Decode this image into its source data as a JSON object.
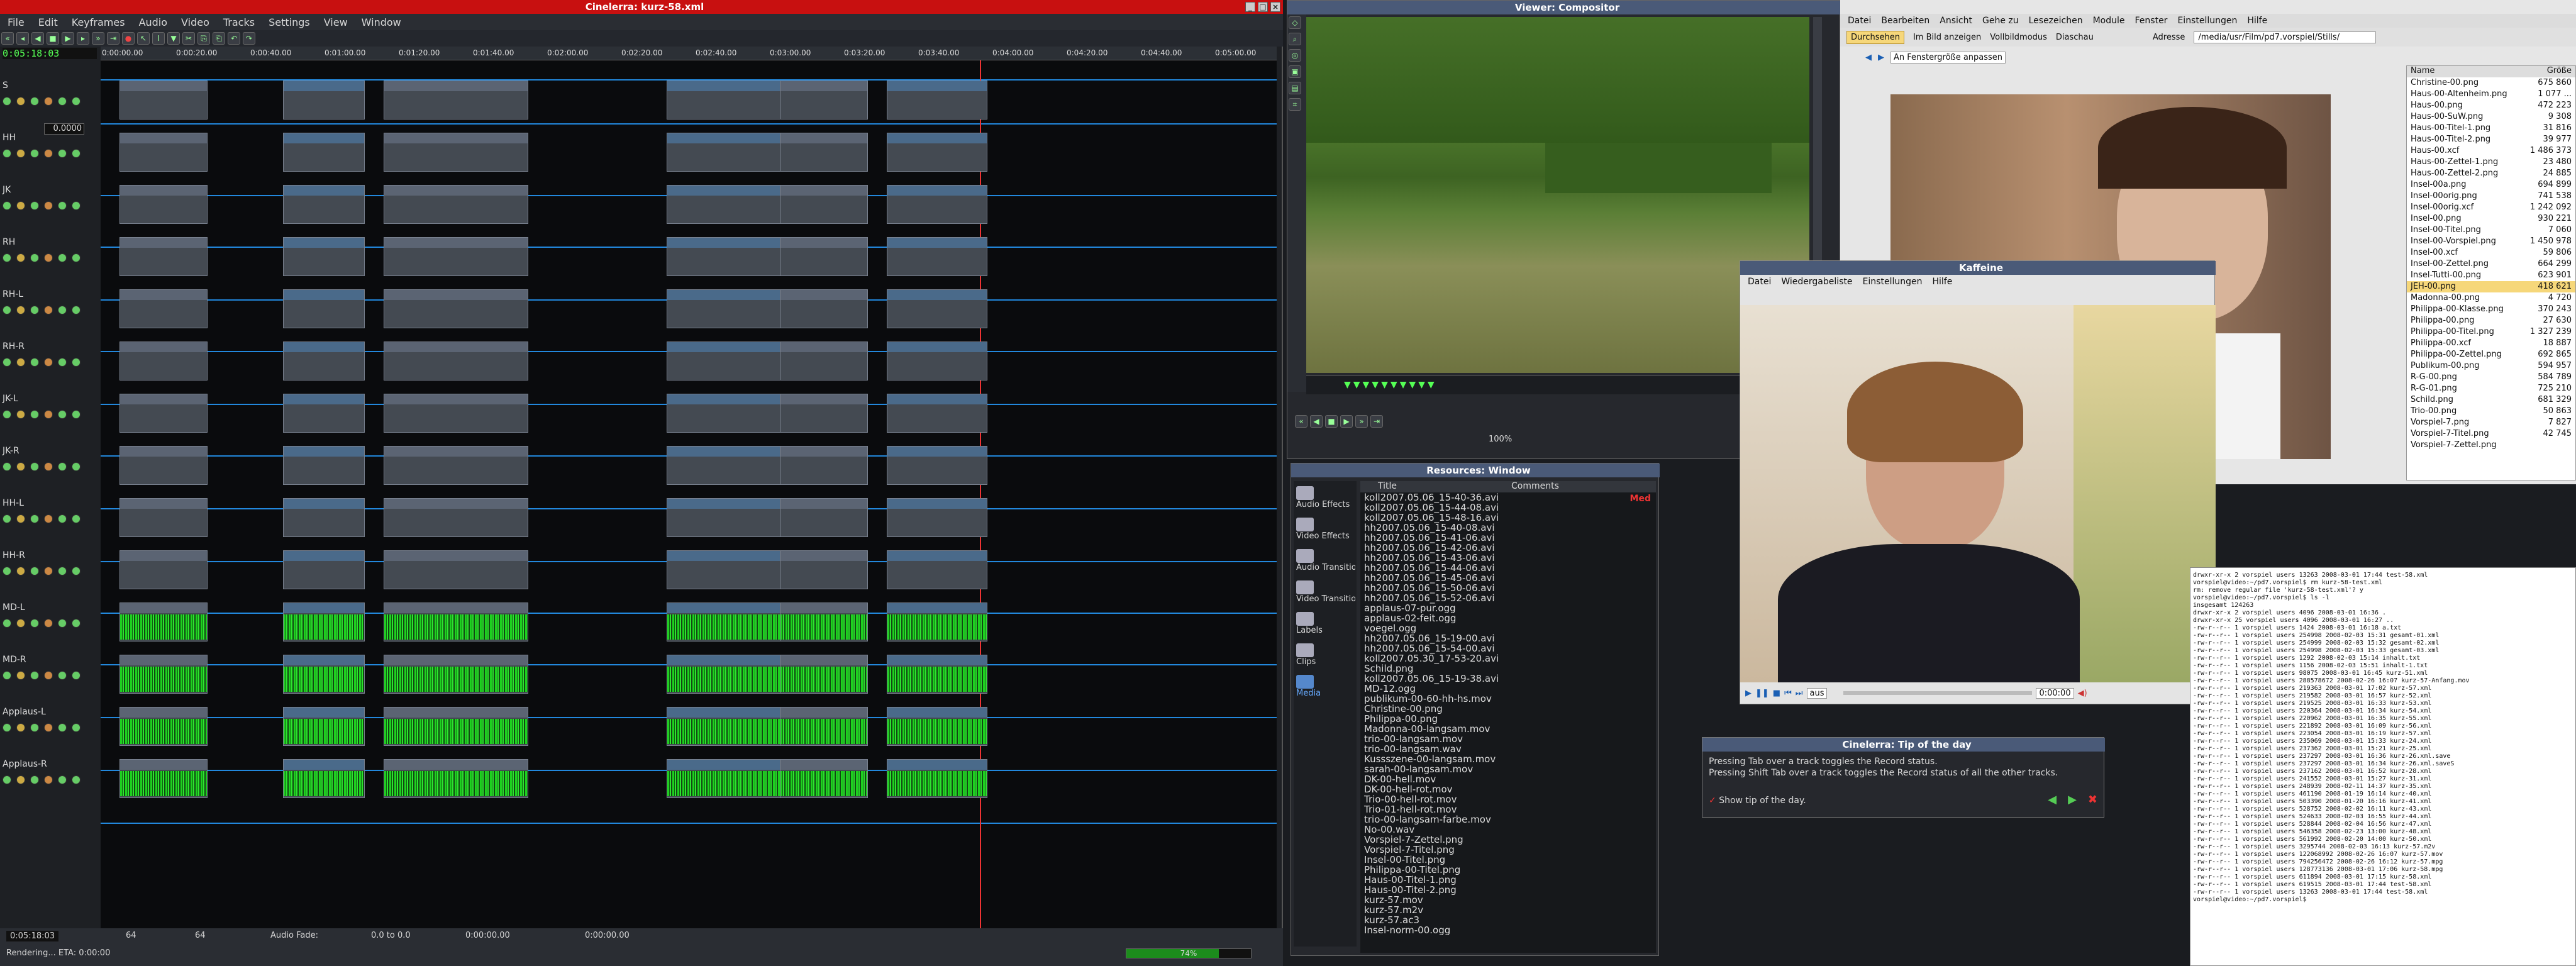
{
  "cinelerra": {
    "title": "Cinelerra: kurz-58.xml",
    "menu": [
      "File",
      "Edit",
      "Keyframes",
      "Audio",
      "Video",
      "Tracks",
      "Settings",
      "View",
      "Window"
    ],
    "timecode": "0:05:18:03",
    "ruler": [
      "0:00:00.00",
      "0:00:20.00",
      "0:00:40.00",
      "0:01:00.00",
      "0:01:20.00",
      "0:01:40.00",
      "0:02:00.00",
      "0:02:20.00",
      "0:02:40.00",
      "0:03:00.00",
      "0:03:20.00",
      "0:03:40.00",
      "0:04:00.00",
      "0:04:20.00",
      "0:04:40.00",
      "0:05:00.00"
    ],
    "zoom_value": "0.0000",
    "tracks": [
      "S",
      "HH",
      "JK",
      "RH",
      "RH-L",
      "RH-R",
      "JK-L",
      "JK-R",
      "HH-L",
      "HH-R",
      "MD-L",
      "MD-R",
      "Applaus-L",
      "Applaus-R"
    ],
    "status": {
      "pos": "0:05:18:03",
      "s1": "64",
      "s2": "64",
      "fade_label": "Audio Fade:",
      "fade": "0.0 to 0.0",
      "t1": "0:00:00.00",
      "t2": "0:00:00.00",
      "rendering": "Rendering... ETA: 0:00:00",
      "progress_pct": "74%",
      "progress": 0.74
    }
  },
  "viewer": {
    "title": "Viewer: Compositor",
    "zoom": "100%"
  },
  "resources": {
    "title": "Resources: Window",
    "folders": [
      "Audio Effects",
      "Video Effects",
      "Audio Transitions",
      "Video Transitions",
      "Labels",
      "Clips",
      "Media"
    ],
    "col_title": "Title",
    "col_comments": "Comments",
    "files": [
      "koll2007.05.06_15-40-36.avi",
      "koll2007.05.06_15-44-08.avi",
      "koll2007.05.06_15-48-16.avi",
      "hh2007.05.06_15-40-08.avi",
      "hh2007.05.06_15-41-06.avi",
      "hh2007.05.06_15-42-06.avi",
      "hh2007.05.06_15-43-06.avi",
      "hh2007.05.06_15-44-06.avi",
      "hh2007.05.06_15-45-06.avi",
      "hh2007.05.06_15-50-06.avi",
      "hh2007.05.06_15-52-06.avi",
      "applaus-07-pur.ogg",
      "applaus-02-feit.ogg",
      "voegel.ogg",
      "hh2007.05.06_15-19-00.avi",
      "hh2007.05.06_15-54-00.avi",
      "koll2007.05.30_17-53-20.avi",
      "Schild.png",
      "koll2007.05.06_15-19-38.avi",
      "MD-12.ogg",
      "publikum-00-60-hh-hs.mov",
      "Christine-00.png",
      "Philippa-00.png",
      "Madonna-00-langsam.mov",
      "trio-00-langsam.mov",
      "trio-00-langsam.wav",
      "Kussszene-00-langsam.mov",
      "sarah-00-langsam.mov",
      "DK-00-hell.mov",
      "DK-00-hell-rot.mov",
      "Trio-00-hell-rot.mov",
      "Trio-01-hell-rot.mov",
      "trio-00-langsam-farbe.mov",
      "No-00.wav",
      "Vorspiel-7-Zettel.png",
      "Vorspiel-7-Titel.png",
      "Insel-00-Titel.png",
      "Philippa-00-Titel.png",
      "Haus-00-Titel-1.png",
      "Haus-00-Titel-2.png",
      "kurz-57.mov",
      "kurz-57.m2v",
      "kurz-57.ac3",
      "Insel-norm-00.ogg"
    ],
    "red": "Med"
  },
  "browser": {
    "menu": [
      "Datei",
      "Bearbeiten",
      "Ansicht",
      "Gehe zu",
      "Lesezeichen",
      "Module",
      "Fenster",
      "Einstellungen",
      "Hilfe"
    ],
    "tb": [
      "Durchsehen",
      "Im Bild anzeigen",
      "Vollbildmodus",
      "Diaschau"
    ],
    "address_label": "Adresse",
    "address": "/media/usr/Film/pd7.vorspiel/Stills/",
    "fit": "An Fenstergröße anpassen",
    "col_name": "Name",
    "col_size": "Größe",
    "files": [
      [
        "Christine-00.png",
        "675 860"
      ],
      [
        "Haus-00-Altenheim.png",
        "1 077 ..."
      ],
      [
        "Haus-00.png",
        "472 223"
      ],
      [
        "Haus-00-SuW.png",
        "9 308"
      ],
      [
        "Haus-00-Titel-1.png",
        "31 816"
      ],
      [
        "Haus-00-Titel-2.png",
        "39 977"
      ],
      [
        "Haus-00.xcf",
        "1 486 373"
      ],
      [
        "Haus-00-Zettel-1.png",
        "23 480"
      ],
      [
        "Haus-00-Zettel-2.png",
        "24 885"
      ],
      [
        "Insel-00a.png",
        "694 899"
      ],
      [
        "Insel-00orig.png",
        "741 538"
      ],
      [
        "Insel-00orig.xcf",
        "1 242 092"
      ],
      [
        "Insel-00.png",
        "930 221"
      ],
      [
        "Insel-00-Titel.png",
        "7 060"
      ],
      [
        "Insel-00-Vorspiel.png",
        "1 450 978"
      ],
      [
        "Insel-00.xcf",
        "59 806"
      ],
      [
        "Insel-00-Zettel.png",
        "664 299"
      ],
      [
        "Insel-Tutti-00.png",
        "623 901"
      ],
      [
        "JEH-00.png",
        "418 621"
      ],
      [
        "Madonna-00.png",
        "4 720"
      ],
      [
        "Philippa-00-Klasse.png",
        "370 243"
      ],
      [
        "Philippa-00.png",
        "27 630"
      ],
      [
        "Philippa-00-Titel.png",
        "1 327 239"
      ],
      [
        "Philippa-00.xcf",
        "18 887"
      ],
      [
        "Philippa-00-Zettel.png",
        "692 865"
      ],
      [
        "Publikum-00.png",
        "594 957"
      ],
      [
        "R-G-00.png",
        "584 789"
      ],
      [
        "R-G-01.png",
        "725 210"
      ],
      [
        "Schild.png",
        "681 329"
      ],
      [
        "Trio-00.png",
        "50 863"
      ],
      [
        "Vorspiel-7.png",
        "7 827"
      ],
      [
        "Vorspiel-7-Titel.png",
        "42 745"
      ],
      [
        "Vorspiel-7-Zettel.png",
        ""
      ]
    ],
    "selected": 18
  },
  "player": {
    "title": "Kaffeine",
    "menu": [
      "Datei",
      "Wiedergabeliste",
      "Einstellungen",
      "Hilfe"
    ],
    "time": "0:00:00",
    "audio": "aus"
  },
  "tip": {
    "title": "Cinelerra: Tip of the day",
    "text1": "Pressing Tab over a track toggles the Record status.",
    "text2": "Pressing Shift Tab over a track toggles the Record status of all the other tracks.",
    "show": "Show tip of the day."
  },
  "terminal": {
    "lines": [
      "drwxr-xr-x  2 vorspiel users       13263 2008-03-01 17:44 test-58.xml",
      "vorspiel@video:~/pd7.vorspiel$ rm kurz-58-test.xml",
      "rm: remove regular file 'kurz-58-test.xml'? y",
      "vorspiel@video:~/pd7.vorspiel$ ls -l",
      "insgesamt 124263",
      "drwxr-xr-x  2 vorspiel users        4096 2008-03-01 16:36 .",
      "drwxr-xr-x 25 vorspiel users        4096 2008-03-01 16:27 ..",
      "-rw-r--r--  1 vorspiel users        1424 2008-03-01 16:18 a.txt",
      "-rw-r--r--  1 vorspiel users      254998 2008-02-03 15:31 gesamt-01.xml",
      "-rw-r--r--  1 vorspiel users      254999 2008-02-03 15:32 gesamt-02.xml",
      "-rw-r--r--  1 vorspiel users      254998 2008-02-03 15:33 gesamt-03.xml",
      "-rw-r--r--  1 vorspiel users        1292 2008-02-03 15:14 inhalt.txt",
      "-rw-r--r--  1 vorspiel users        1156 2008-02-03 15:51 inhalt-1.txt",
      "-rw-r--r--  1 vorspiel users       98075 2008-03-01 16:45 kurz-51.xml",
      "-rw-r--r--  1 vorspiel users   288578672 2008-02-26 16:07 kurz-57-Anfang.mov",
      "-rw-r--r--  1 vorspiel users      219363 2008-03-01 17:02 kurz-57.xml",
      "-rw-r--r--  1 vorspiel users      219582 2008-03-01 16:57 kurz-52.xml",
      "-rw-r--r--  1 vorspiel users      219525 2008-03-01 16:33 kurz-53.xml",
      "-rw-r--r--  1 vorspiel users      220364 2008-03-01 16:34 kurz-54.xml",
      "-rw-r--r--  1 vorspiel users      220962 2008-03-01 16:35 kurz-55.xml",
      "-rw-r--r--  1 vorspiel users      221892 2008-03-01 16:09 kurz-56.xml",
      "-rw-r--r--  1 vorspiel users      223054 2008-03-01 16:19 kurz-57.xml",
      "-rw-r--r--  1 vorspiel users      235069 2008-03-01 15:33 kurz-24.xml",
      "-rw-r--r--  1 vorspiel users      237362 2008-03-01 15:21 kurz-25.xml",
      "-rw-r--r--  1 vorspiel users      237297 2008-03-01 16:36 kurz-26.xml.save",
      "-rw-r--r--  1 vorspiel users      237297 2008-03-01 16:34 kurz-26.xml.saveS",
      "-rw-r--r--  1 vorspiel users      237162 2008-03-01 16:52 kurz-28.xml",
      "-rw-r--r--  1 vorspiel users      241552 2008-03-01 15:27 kurz-31.xml",
      "-rw-r--r--  1 vorspiel users      248939 2008-02-11 14:37 kurz-35.xml",
      "-rw-r--r--  1 vorspiel users      461190 2008-01-19 16:14 kurz-40.xml",
      "-rw-r--r--  1 vorspiel users      503390 2008-01-20 16:16 kurz-41.xml",
      "-rw-r--r--  1 vorspiel users      528752 2008-02-02 16:11 kurz-43.xml",
      "-rw-r--r--  1 vorspiel users      524633 2008-02-03 16:55 kurz-44.xml",
      "-rw-r--r--  1 vorspiel users      528844 2008-02-04 16:56 kurz-47.xml",
      "-rw-r--r--  1 vorspiel users      546358 2008-02-23 13:00 kurz-48.xml",
      "-rw-r--r--  1 vorspiel users      561992 2008-02-20 14:00 kurz-50.xml",
      "-rw-r--r--  1 vorspiel users     3295744 2008-02-03 16:13 kurz-57.m2v",
      "-rw-r--r--  1 vorspiel users   122068992 2008-02-26 16:07 kurz-57.mov",
      "-rw-r--r--  1 vorspiel users   794256472 2008-02-26 16:12 kurz-57.mpg",
      "-rw-r--r--  1 vorspiel users   128773136 2008-03-01 17:06 kurz-58.mpg",
      "-rw-r--r--  1 vorspiel users      611894 2008-03-01 17:15 kurz-58.xml",
      "-rw-r--r--  1 vorspiel users      619515 2008-03-01 17:44 test-58.xml",
      "-rw-r--r--  1 vorspiel users       13263 2008-03-01 17:44 test-58.xml",
      "vorspiel@video:~/pd7.vorspiel$"
    ]
  },
  "colors": {
    "accent": "#2288dd",
    "wave": "#19e019",
    "titlebar_active": "#d01010",
    "titlebar": "#4a5a78"
  }
}
